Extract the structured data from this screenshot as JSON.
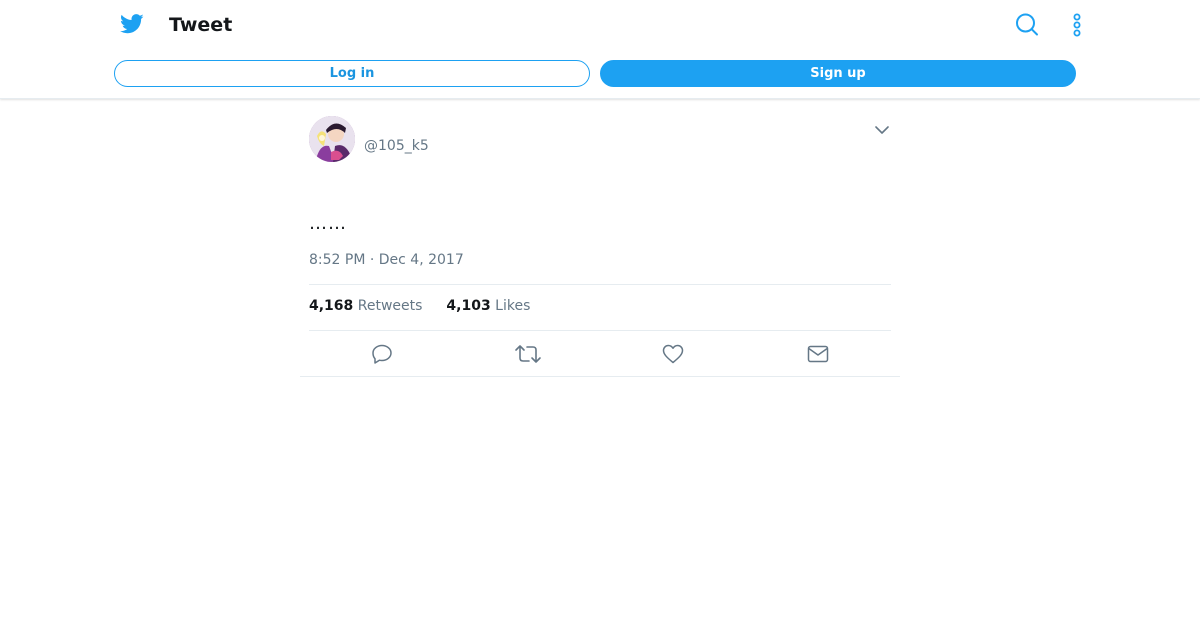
{
  "header": {
    "title": "Tweet",
    "logo_icon": "twitter-bird-icon",
    "search_icon": "search-icon",
    "more_icon": "more-vertical-icon",
    "login_label": "Log in",
    "signup_label": "Sign up",
    "brand_color": "#1da1f2"
  },
  "tweet": {
    "handle": "@105_k5",
    "text": "……",
    "timestamp": "8:52 PM · Dec 4, 2017",
    "retweets_count": "4,168",
    "retweets_label": "Retweets",
    "likes_count": "4,103",
    "likes_label": "Likes",
    "caret_icon": "chevron-down-icon",
    "actions": [
      "reply-icon",
      "retweet-icon",
      "like-icon",
      "direct-message-icon"
    ]
  }
}
